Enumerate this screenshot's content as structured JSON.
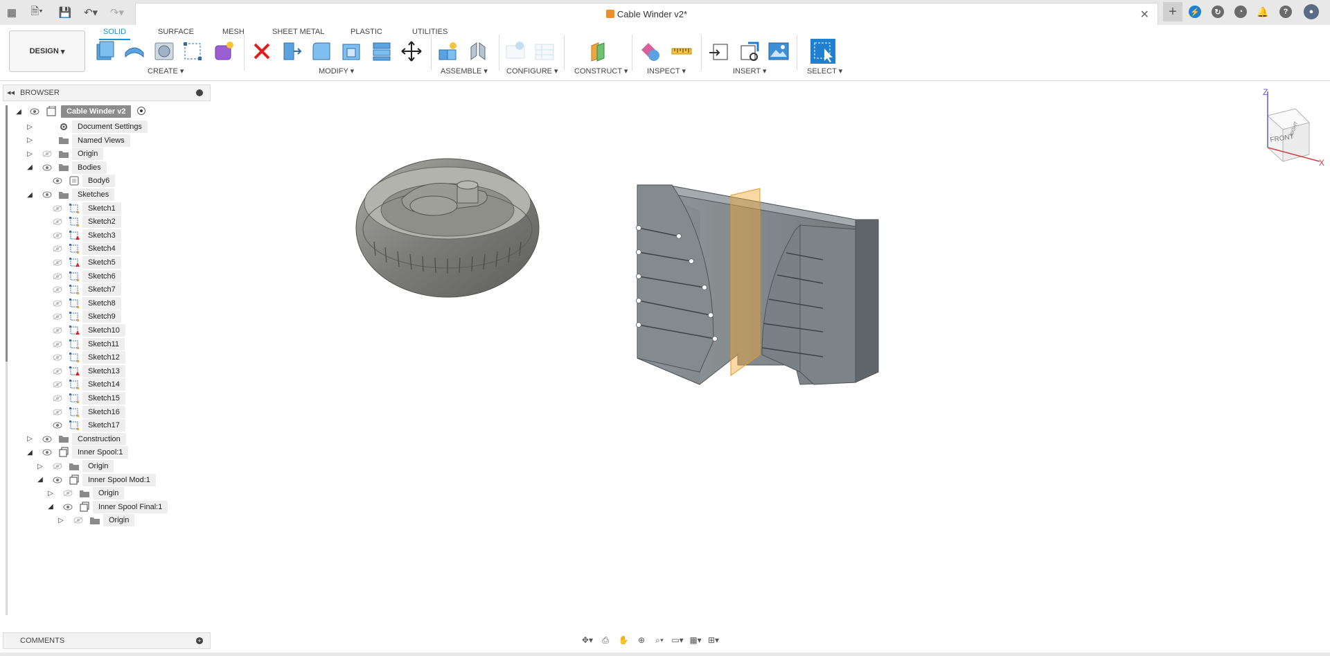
{
  "app": {
    "document_title": "Cable Winder v2*"
  },
  "toolbar": {
    "workspace": "DESIGN",
    "tabs": [
      "SOLID",
      "SURFACE",
      "MESH",
      "SHEET METAL",
      "PLASTIC",
      "UTILITIES"
    ],
    "active_tab": "SOLID",
    "groups": [
      "CREATE",
      "MODIFY",
      "ASSEMBLE",
      "CONFIGURE",
      "CONSTRUCT",
      "INSPECT",
      "INSERT",
      "SELECT"
    ]
  },
  "browser": {
    "header": "BROWSER",
    "root": "Cable Winder v2",
    "items": [
      {
        "label": "Document Settings",
        "icon": "gear-icon"
      },
      {
        "label": "Named Views",
        "icon": "folder-icon"
      },
      {
        "label": "Origin",
        "icon": "folder-icon"
      },
      {
        "label": "Bodies",
        "icon": "folder-icon"
      },
      {
        "label": "Body6",
        "icon": "body-icon"
      },
      {
        "label": "Sketches",
        "icon": "folder-icon"
      },
      {
        "label": "Sketch1",
        "icon": "sketch-icon"
      },
      {
        "label": "Sketch2",
        "icon": "sketch-icon"
      },
      {
        "label": "Sketch3",
        "icon": "sketch-warning-icon"
      },
      {
        "label": "Sketch4",
        "icon": "sketch-icon"
      },
      {
        "label": "Sketch5",
        "icon": "sketch-warning-icon"
      },
      {
        "label": "Sketch6",
        "icon": "sketch-icon"
      },
      {
        "label": "Sketch7",
        "icon": "sketch-icon"
      },
      {
        "label": "Sketch8",
        "icon": "sketch-icon"
      },
      {
        "label": "Sketch9",
        "icon": "sketch-icon"
      },
      {
        "label": "Sketch10",
        "icon": "sketch-warning-icon"
      },
      {
        "label": "Sketch11",
        "icon": "sketch-icon"
      },
      {
        "label": "Sketch12",
        "icon": "sketch-icon"
      },
      {
        "label": "Sketch13",
        "icon": "sketch-warning-icon"
      },
      {
        "label": "Sketch14",
        "icon": "sketch-icon"
      },
      {
        "label": "Sketch15",
        "icon": "sketch-icon"
      },
      {
        "label": "Sketch16",
        "icon": "sketch-icon"
      },
      {
        "label": "Sketch17",
        "icon": "sketch-icon"
      },
      {
        "label": "Construction",
        "icon": "folder-icon"
      },
      {
        "label": "Inner Spool:1",
        "icon": "component-icon"
      },
      {
        "label": "Origin",
        "icon": "folder-icon"
      },
      {
        "label": "Inner Spool Mod:1",
        "icon": "component-icon"
      },
      {
        "label": "Origin",
        "icon": "folder-icon"
      },
      {
        "label": "Inner Spool Final:1",
        "icon": "component-icon"
      },
      {
        "label": "Origin",
        "icon": "folder-icon"
      }
    ]
  },
  "comments": {
    "header": "COMMENTS"
  },
  "viewcube": {
    "front": "FRONT",
    "right": "RIGHT",
    "axis_z": "Z",
    "axis_x": "X"
  }
}
